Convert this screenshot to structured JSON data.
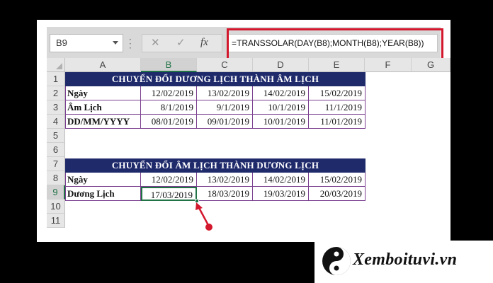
{
  "formula_bar": {
    "name_box": "B9",
    "cancel_icon": "close-icon",
    "enter_icon": "check-icon",
    "fx_label": "fx",
    "formula": "=TRANSSOLAR(DAY(B8);MONTH(B8);YEAR(B8))"
  },
  "columns": [
    "A",
    "B",
    "C",
    "D",
    "E",
    "F",
    "G"
  ],
  "rows": [
    "1",
    "2",
    "3",
    "4",
    "5",
    "6",
    "7",
    "8",
    "9",
    "10",
    "11"
  ],
  "selected_column": "B",
  "selected_row": "9",
  "table1": {
    "title": "CHUYỂN ĐỔI DƯƠNG LỊCH THÀNH ÂM LỊCH",
    "rows": [
      {
        "label": "Ngày",
        "values": [
          "12/02/2019",
          "13/02/2019",
          "14/02/2019",
          "15/02/2019"
        ]
      },
      {
        "label": "Âm Lịch",
        "values": [
          "8/1/2019",
          "9/1/2019",
          "10/1/2019",
          "11/1/2019"
        ]
      },
      {
        "label": "DD/MM/YYYY",
        "values": [
          "08/01/2019",
          "09/01/2019",
          "10/01/2019",
          "11/01/2019"
        ]
      }
    ]
  },
  "table2": {
    "title": "CHUYỂN ĐỔI ÂM LỊCH THÀNH DƯƠNG LỊCH",
    "rows": [
      {
        "label": "Ngày",
        "values": [
          "12/02/2019",
          "13/02/2019",
          "14/02/2019",
          "15/02/2019"
        ]
      },
      {
        "label": "Dương Lịch",
        "values": [
          "17/03/2019",
          "18/03/2019",
          "19/03/2019",
          "20/03/2019"
        ]
      }
    ]
  },
  "colors": {
    "header_fill": "#1f2a6b",
    "highlight_red": "#d3172d",
    "excel_green": "#217346"
  },
  "logo": {
    "icon": "yin-yang-icon",
    "text": "Xemboituvi.vn"
  }
}
